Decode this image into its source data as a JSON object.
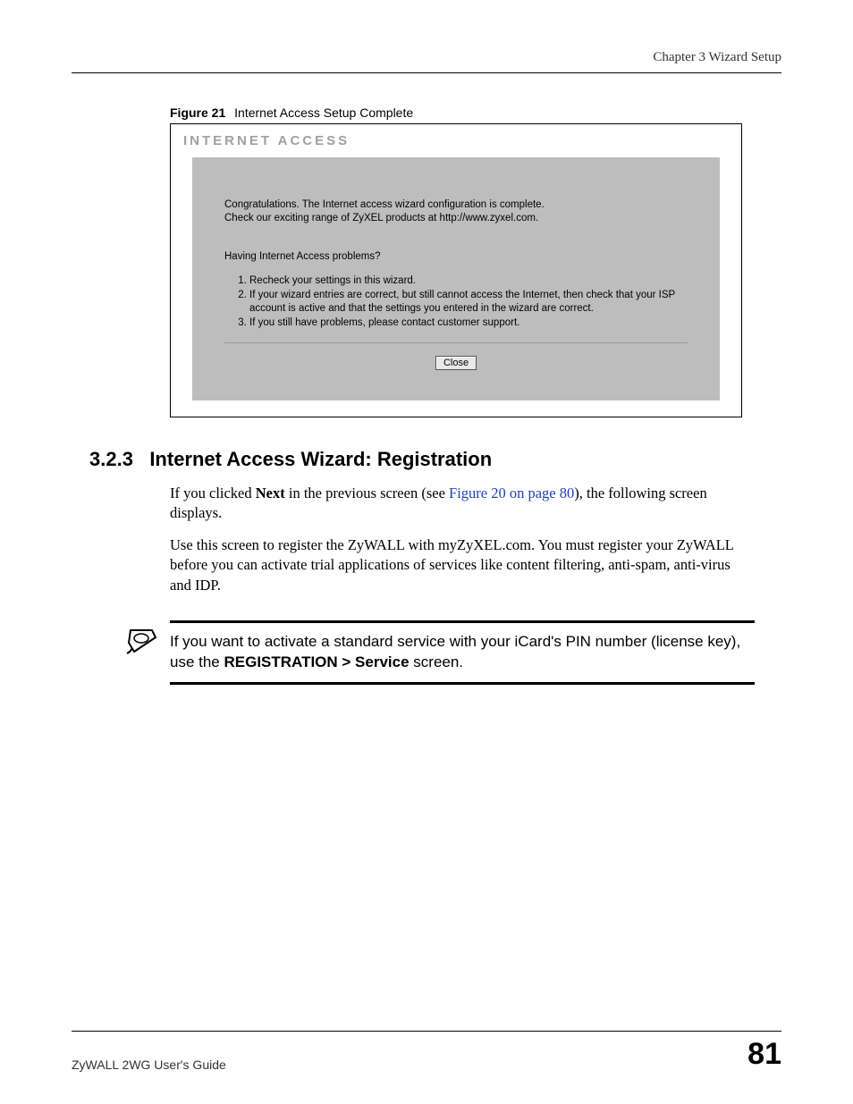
{
  "header": {
    "chapter": "Chapter 3 Wizard Setup"
  },
  "figure": {
    "label": "Figure 21",
    "caption": "Internet Access Setup Complete",
    "title": "INTERNET ACCESS",
    "congrats_line1": "Congratulations. The Internet access wizard configuration is complete.",
    "congrats_line2": "Check our exciting range of ZyXEL products at http://www.zyxel.com.",
    "problems_q": "Having Internet Access problems?",
    "steps": [
      "Recheck your settings in this wizard.",
      "If your wizard entries are correct, but still cannot access the Internet, then check that your ISP account is active and that the settings you entered in the wizard are correct.",
      "If you still have problems, please contact customer support."
    ],
    "close_label": "Close"
  },
  "section": {
    "number": "3.2.3",
    "title": "Internet Access Wizard: Registration",
    "p1_pre": "If you clicked ",
    "p1_bold": "Next",
    "p1_mid": " in the previous screen (see ",
    "p1_link": "Figure 20 on page 80",
    "p1_post": "), the following screen displays.",
    "p2": "Use this screen to register the ZyWALL with myZyXEL.com. You must register your ZyWALL before you can activate trial applications of services like content filtering, anti-spam, anti-virus and IDP."
  },
  "note": {
    "line1": "If you want to activate a standard service with your iCard's PIN number (license key), use the ",
    "bold": "REGISTRATION > Service",
    "line2": " screen."
  },
  "footer": {
    "guide": "ZyWALL 2WG User's Guide",
    "page": "81"
  }
}
